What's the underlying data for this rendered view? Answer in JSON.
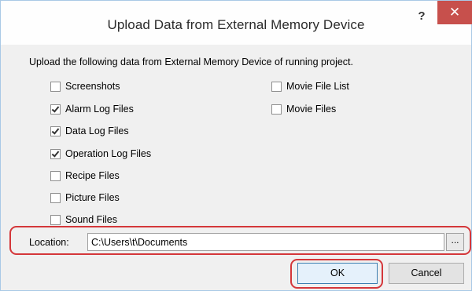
{
  "window": {
    "title": "Upload Data from External Memory Device",
    "help_label": "?",
    "close_label": "✕"
  },
  "description": "Upload the following data from External Memory Device of running project.",
  "checkboxes_left": [
    {
      "label": "Screenshots",
      "checked": false
    },
    {
      "label": "Alarm Log Files",
      "checked": true
    },
    {
      "label": "Data Log Files",
      "checked": true
    },
    {
      "label": "Operation Log Files",
      "checked": true
    },
    {
      "label": "Recipe Files",
      "checked": false
    },
    {
      "label": "Picture Files",
      "checked": false
    },
    {
      "label": "Sound Files",
      "checked": false
    }
  ],
  "checkboxes_right": [
    {
      "label": "Movie File List",
      "checked": false
    },
    {
      "label": "Movie Files",
      "checked": false
    }
  ],
  "location": {
    "label": "Location:",
    "value": "C:\\Users\\t\\Documents",
    "browse_label": "..."
  },
  "buttons": {
    "ok_label": "OK",
    "cancel_label": "Cancel"
  },
  "colors": {
    "highlight": "#d4373a",
    "close_button": "#c7504c"
  }
}
